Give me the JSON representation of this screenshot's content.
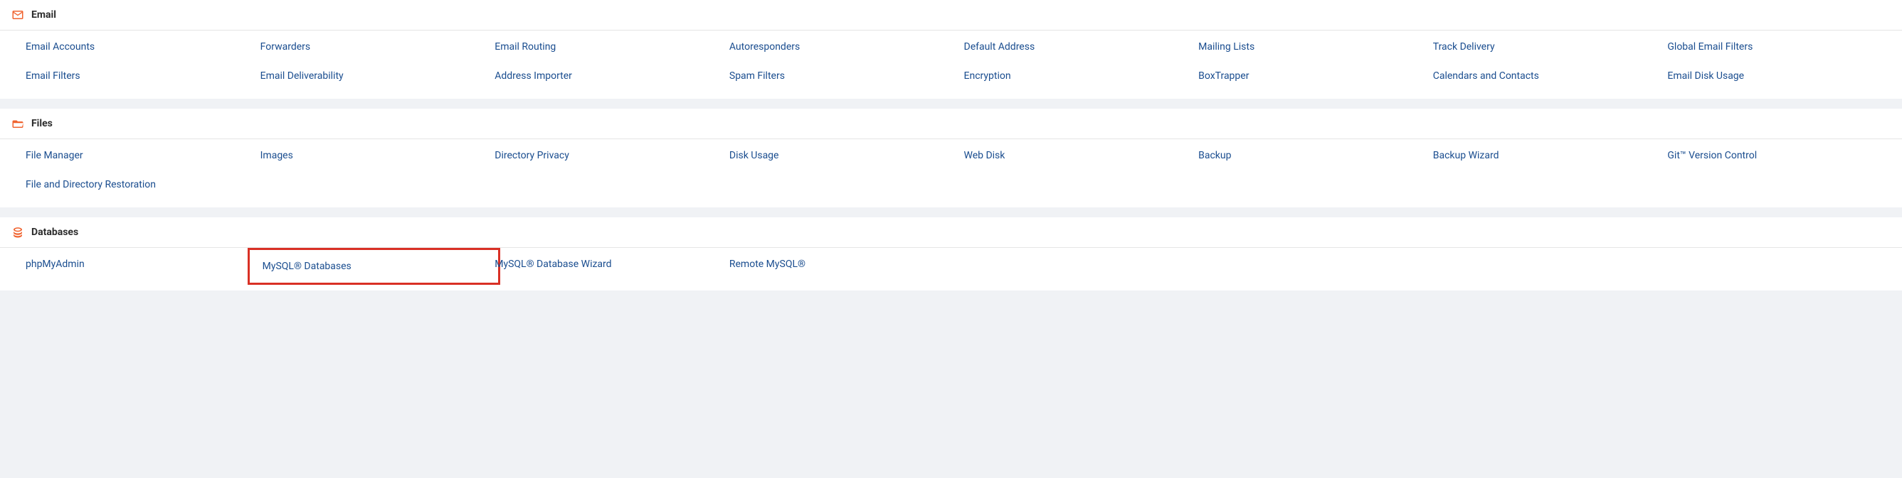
{
  "sections": {
    "email": {
      "title": "Email",
      "items": [
        "Email Accounts",
        "Forwarders",
        "Email Routing",
        "Autoresponders",
        "Default Address",
        "Mailing Lists",
        "Track Delivery",
        "Global Email Filters",
        "Email Filters",
        "Email Deliverability",
        "Address Importer",
        "Spam Filters",
        "Encryption",
        "BoxTrapper",
        "Calendars and Contacts",
        "Email Disk Usage"
      ]
    },
    "files": {
      "title": "Files",
      "items": [
        "File Manager",
        "Images",
        "Directory Privacy",
        "Disk Usage",
        "Web Disk",
        "Backup",
        "Backup Wizard",
        "Git™ Version Control",
        "File and Directory Restoration"
      ]
    },
    "databases": {
      "title": "Databases",
      "items": [
        "phpMyAdmin",
        "MySQL® Databases",
        "MySQL® Database Wizard",
        "Remote MySQL®"
      ]
    }
  }
}
